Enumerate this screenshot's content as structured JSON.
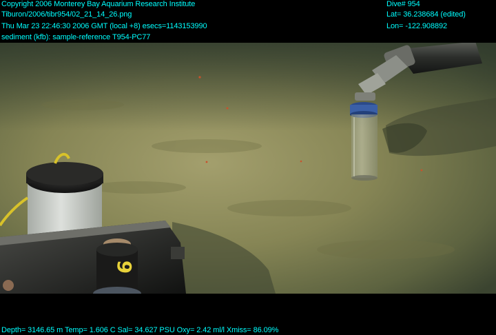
{
  "overlay": {
    "copyright": "Copyright 2006 Monterey Bay Aquarium Research Institute",
    "file_path": "Tiburon/2006/tibr954/02_21_14_26.png",
    "timestamp": "Thu Mar 23 22:46:30 2006 GMT (local +8)  esecs=1143153990",
    "sample": "sediment (kfb): sample-reference T954-PC77",
    "dive": "Dive# 954",
    "lat": "Lat= 36.238684 (edited)",
    "lon": "Lon= -122.908892",
    "sensors": "Depth= 3146.65 m  Temp= 1.606 C  Sal= 34.627 PSU  Oxy= 2.42 ml/l  Xmiss= 86.09%"
  },
  "colors": {
    "overlay_text": "#00ffff",
    "seafloor": "#8b8a5a",
    "background": "#000000"
  },
  "scene": {
    "subject": "ROV manipulator arm placing a push core tube into sediment on the seafloor",
    "equipment_marking": "6"
  }
}
